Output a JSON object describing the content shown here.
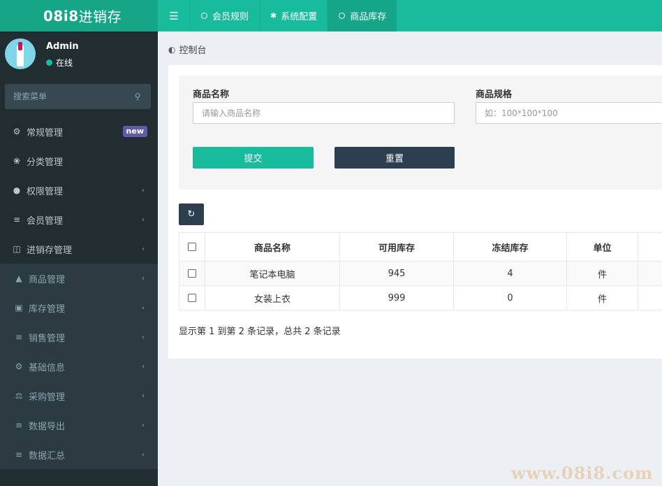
{
  "header": {
    "logo_prefix": "08i8",
    "logo_suffix": "进销存",
    "tabs": [
      {
        "label": "会员规则",
        "icon": "circle-icon"
      },
      {
        "label": "系统配置",
        "icon": "gear-icon"
      },
      {
        "label": "商品库存",
        "icon": "circle-icon",
        "active": true
      }
    ]
  },
  "sidebar": {
    "user_name": "Admin",
    "user_status": "在线",
    "search_placeholder": "搜索菜单",
    "items": [
      {
        "label": "常规管理",
        "icon": "gears-icon",
        "badge": "new"
      },
      {
        "label": "分类管理",
        "icon": "leaf-icon"
      },
      {
        "label": "权限管理",
        "icon": "users-icon"
      },
      {
        "label": "会员管理",
        "icon": "list-icon"
      },
      {
        "label": "进销存管理",
        "icon": "file-icon"
      }
    ],
    "subitems": [
      {
        "label": "商品管理",
        "icon": "shopping-bag-icon"
      },
      {
        "label": "库存管理",
        "icon": "archive-icon"
      },
      {
        "label": "销售管理",
        "icon": "list-icon"
      },
      {
        "label": "基础信息",
        "icon": "gears-icon"
      },
      {
        "label": "采购管理",
        "icon": "balance-scale-icon"
      },
      {
        "label": "数据导出",
        "icon": "list-icon"
      },
      {
        "label": "数据汇总",
        "icon": "list-icon"
      }
    ]
  },
  "content": {
    "breadcrumb": "控制台",
    "form": {
      "name_label": "商品名称",
      "name_placeholder": "请输入商品名称",
      "spec_label": "商品规格",
      "spec_placeholder": "如：100*100*100",
      "submit_label": "提交",
      "reset_label": "重置"
    },
    "table": {
      "headers": [
        "商品名称",
        "可用库存",
        "冻结库存",
        "单位"
      ],
      "rows": [
        [
          "笔记本电脑",
          "945",
          "4",
          "件"
        ],
        [
          "女装上衣",
          "999",
          "0",
          "件"
        ]
      ]
    },
    "pagination_info": "显示第 1 到第 2 条记录，总共 2 条记录"
  },
  "watermark": "www.08i8.com"
}
